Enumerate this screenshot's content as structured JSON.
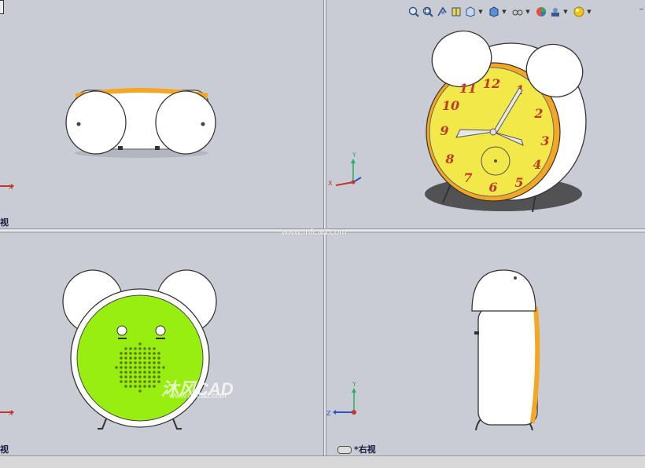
{
  "views": {
    "top_left_label": "视",
    "bottom_left_label": "视",
    "bottom_right_label": "*右视"
  },
  "axes": {
    "x": "X",
    "y": "Y",
    "z": "Z"
  },
  "watermark": {
    "url": "www.mfcad.com",
    "brand": "沐风CAD",
    "brand_url": "www.mfcad.com"
  },
  "toolbar_icons": [
    "zoom-to-fit-icon",
    "zoom-area-icon",
    "previous-view-icon",
    "section-view-icon",
    "view-orientation-icon",
    "display-style-icon",
    "hide-show-icon",
    "edit-appearance-icon",
    "apply-scene-icon",
    "view-settings-icon"
  ],
  "clock": {
    "numerals": [
      "12",
      "1",
      "2",
      "3",
      "4",
      "5",
      "6",
      "7",
      "8",
      "9",
      "10",
      "11"
    ]
  },
  "colors": {
    "face_yellow": "#f2e84a",
    "back_green": "#99ee11",
    "rim_orange": "#f5a623",
    "numeral_red": "#c0392b",
    "viewport_bg": "#c9ccd4"
  }
}
